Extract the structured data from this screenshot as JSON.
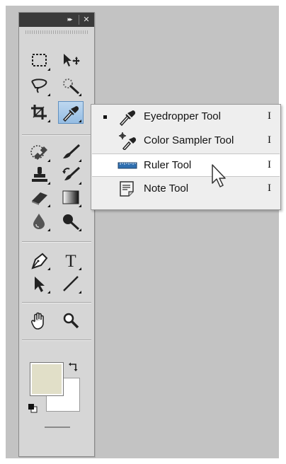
{
  "panel": {
    "collapse_glyph": "▸▸",
    "close_glyph": "✕"
  },
  "tools": [
    {
      "name": "rectangular-marquee-tool",
      "icon": "marquee-icon"
    },
    {
      "name": "move-tool",
      "icon": "move-icon"
    },
    {
      "name": "lasso-tool",
      "icon": "lasso-icon"
    },
    {
      "name": "magic-wand-tool",
      "icon": "magic-wand-icon"
    },
    {
      "name": "crop-tool",
      "icon": "crop-icon"
    },
    {
      "name": "eyedropper-tool",
      "icon": "eyedropper-icon",
      "active": true
    },
    {
      "name": "spot-healing-brush-tool",
      "icon": "bandage-icon"
    },
    {
      "name": "brush-tool",
      "icon": "brush-icon"
    },
    {
      "name": "clone-stamp-tool",
      "icon": "stamp-icon"
    },
    {
      "name": "history-brush-tool",
      "icon": "history-brush-icon"
    },
    {
      "name": "eraser-tool",
      "icon": "eraser-icon"
    },
    {
      "name": "gradient-tool",
      "icon": "gradient-icon"
    },
    {
      "name": "blur-tool",
      "icon": "drop-icon"
    },
    {
      "name": "dodge-tool",
      "icon": "dodge-icon"
    },
    {
      "name": "pen-tool",
      "icon": "pen-icon"
    },
    {
      "name": "type-tool",
      "icon": "type-icon",
      "glyph": "T"
    },
    {
      "name": "path-selection-tool",
      "icon": "arrow-icon"
    },
    {
      "name": "line-tool",
      "icon": "line-icon"
    },
    {
      "name": "hand-tool",
      "icon": "hand-icon"
    },
    {
      "name": "zoom-tool",
      "icon": "zoom-icon"
    }
  ],
  "colors": {
    "foreground": "#e1dfc8",
    "background": "#ffffff"
  },
  "flyout": {
    "items": [
      {
        "label": "Eyedropper Tool",
        "shortcut": "I",
        "icon": "eyedropper-icon",
        "selected": true
      },
      {
        "label": "Color Sampler Tool",
        "shortcut": "I",
        "icon": "color-sampler-icon"
      },
      {
        "label": "Ruler Tool",
        "shortcut": "I",
        "icon": "ruler-icon",
        "hovered": true
      },
      {
        "label": "Note Tool",
        "shortcut": "I",
        "icon": "note-icon"
      }
    ]
  }
}
